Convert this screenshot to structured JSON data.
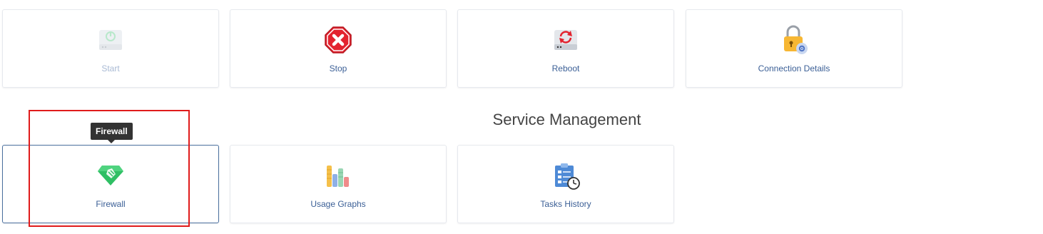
{
  "actions": {
    "start": {
      "label": "Start",
      "icon": "power-drive-icon",
      "enabled": false
    },
    "stop": {
      "label": "Stop",
      "icon": "stop-sign-icon",
      "enabled": true
    },
    "reboot": {
      "label": "Reboot",
      "icon": "reboot-drive-icon",
      "enabled": true
    },
    "connection_details": {
      "label": "Connection Details",
      "icon": "padlock-gear-icon",
      "enabled": true
    }
  },
  "service_management": {
    "title": "Service Management",
    "firewall": {
      "label": "Firewall",
      "icon": "firewall-gem-icon",
      "active": true
    },
    "usage_graphs": {
      "label": "Usage Graphs",
      "icon": "bar-columns-icon"
    },
    "tasks_history": {
      "label": "Tasks History",
      "icon": "clipboard-clock-icon"
    }
  },
  "tooltip": {
    "text": "Firewall"
  },
  "colors": {
    "label": "#3b5f96",
    "label_disabled": "#a9bad4",
    "active_border": "#4a6f9e",
    "highlight": "#e01b1b",
    "tooltip_bg": "#333333"
  }
}
